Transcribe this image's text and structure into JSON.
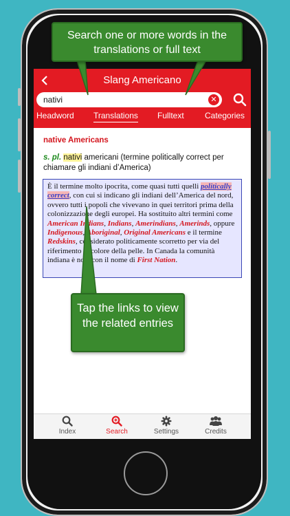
{
  "app": {
    "title": "Slang Americano"
  },
  "search": {
    "value": "nativi"
  },
  "tabs": [
    {
      "label": "Headword"
    },
    {
      "label": "Translations",
      "active": true
    },
    {
      "label": "Fulltext"
    },
    {
      "label": "Categories"
    }
  ],
  "entry": {
    "headword": "native Americans",
    "pos": "s. pl.",
    "highlight": "nativi",
    "translation_rest": " americani (termine politically correct per chiamare gli indiani d’America)"
  },
  "note": {
    "t1": "È il termine molto ipocrita, come quasi tutti quelli ",
    "link1": "politically correct",
    "t2": ", con cui si indicano gli indiani dell’America del nord, ovvero tutti i popoli che vivevano in quei territori prima della colonizzazione degli europei. Ha sostituito altri termini come ",
    "link2": "American Indians",
    "t3": ", ",
    "link3": "Indians",
    "t4": ", ",
    "link4": "Amerindians",
    "t5": ", ",
    "link5": "Amerinds",
    "t6": ", oppure ",
    "link6": "Indigenous",
    "t7": ", ",
    "link7": "Aboriginal",
    "t8": ", ",
    "link8": "Original Americans",
    "t9": " e il termine ",
    "link9": "Redskins",
    "t10": ", considerato politicamente scorretto per via del riferimento al colore della pelle. In Canada la comunità indiana è nota con il nome di ",
    "link10": "First Nation",
    "t11": "."
  },
  "bottom_nav": [
    {
      "label": "Index",
      "icon": "search-icon"
    },
    {
      "label": "Search",
      "icon": "zoom-in-icon",
      "active": true
    },
    {
      "label": "Settings",
      "icon": "gear-icon"
    },
    {
      "label": "Credits",
      "icon": "people-icon"
    }
  ],
  "callouts": {
    "top": "Search one or more words in the translations or full text",
    "mid": "Tap the links to view the related entries"
  },
  "colors": {
    "background": "#3fb6c2",
    "brand_red": "#e31b23",
    "callout_green": "#3a8a2e",
    "note_bg": "#e6e6ff"
  }
}
